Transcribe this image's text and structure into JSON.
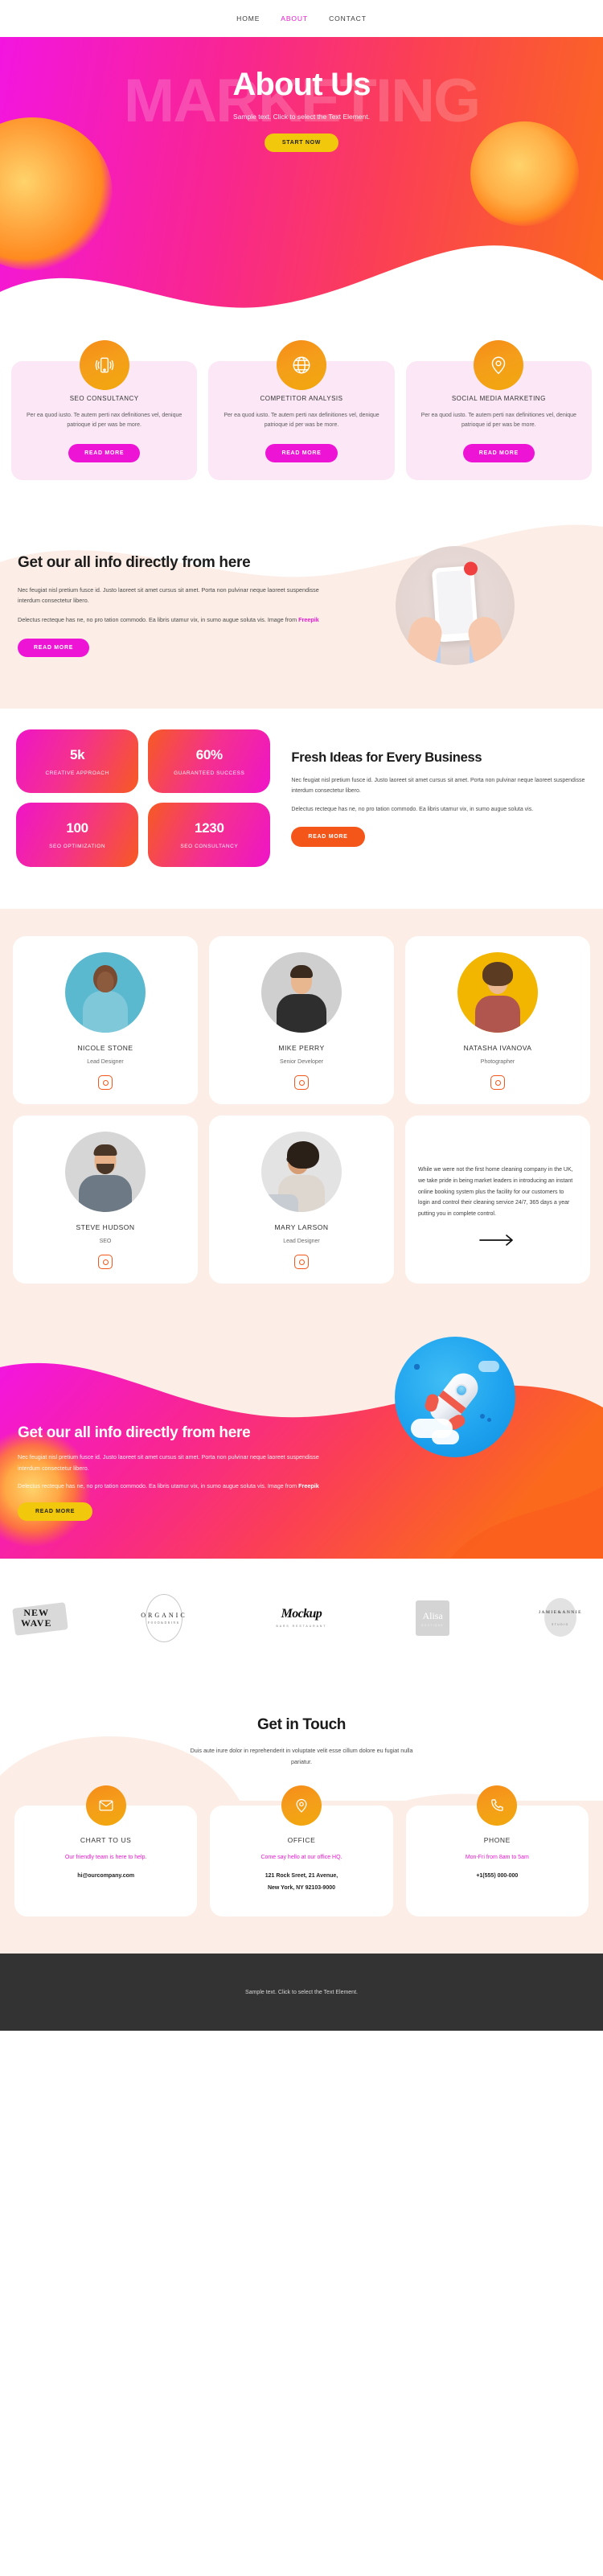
{
  "nav": {
    "items": [
      {
        "label": "HOME",
        "active": false
      },
      {
        "label": "ABOUT",
        "active": true
      },
      {
        "label": "CONTACT",
        "active": false
      }
    ]
  },
  "hero": {
    "ghost_word": "MARKETING",
    "title": "About Us",
    "subtitle": "Sample text. Click to select the Text Element.",
    "cta_label": "START NOW"
  },
  "services": {
    "cards": [
      {
        "icon": "mobile-phone-icon",
        "title": "SEO CONSULTANCY",
        "text": "Per ea quod iusto. Te autem perti nax definitiones vel, denique patrioque id per was be more.",
        "button": "READ MORE"
      },
      {
        "icon": "globe-icon",
        "title": "COMPETITOR ANALYSIS",
        "text": "Per ea quod iusto. Te autem perti nax definitiones vel, denique patrioque id per was be more.",
        "button": "READ MORE"
      },
      {
        "icon": "map-pin-icon",
        "title": "SOCIAL MEDIA MARKETING",
        "text": "Per ea quod iusto. Te autem perti nax definitiones vel, denique patrioque id per was be more.",
        "button": "READ MORE"
      }
    ]
  },
  "info": {
    "title": "Get our all info directly from here",
    "paragraph1": "Nec feugiat nisl pretium fusce id. Justo laoreet sit amet cursus sit amet. Porta non pulvinar neque laoreet suspendisse interdum consectetur libero.",
    "paragraph2_prefix": "Delectus recteque has ne, no pro tation commodo. Ea libris utamur vix, in sumo augue soluta vis. Image from ",
    "paragraph2_link": "Freepik",
    "button": "READ MORE"
  },
  "stats": {
    "items": [
      {
        "number": "5k",
        "label": "CREATIVE APPROACH"
      },
      {
        "number": "60%",
        "label": "GUARANTEED SUCCESS"
      },
      {
        "number": "100",
        "label": "SEO OPTIMIZATION"
      },
      {
        "number": "1230",
        "label": "SEO CONSULTANCY"
      }
    ],
    "title": "Fresh Ideas for Every Business",
    "paragraph1": "Nec feugiat nisl pretium fusce id. Justo laoreet sit amet cursus sit amet. Porta non pulvinar neque laoreet suspendisse interdum consectetur libero.",
    "paragraph2": "Delectus recteque has ne, no pro tation commodo. Ea libris utamur vix, in sumo augue soluta vis.",
    "button": "READ MORE"
  },
  "team": {
    "members": [
      {
        "name": "NICOLE STONE",
        "role": "Lead Designer"
      },
      {
        "name": "MIKE PERRY",
        "role": "Senior Developer"
      },
      {
        "name": "NATASHA IVANOVA",
        "role": "Photographer"
      },
      {
        "name": "STEVE HUDSON",
        "role": "SEO"
      },
      {
        "name": "MARY LARSON",
        "role": "Lead Designer"
      }
    ],
    "quote": "While we were not the first home cleaning company in the UK, we take pride in being market leaders in introducing an instant online booking system plus the facility for our customers to login and control their cleaning service 24/7, 365 days a year putting you in complete control."
  },
  "cta": {
    "title": "Get our all info directly from here",
    "paragraph1": "Nec feugiat nisl pretium fusce id. Justo laoreet sit amet cursus sit amet. Porta non pulvinar neque laoreet suspendisse interdum consectetur libero.",
    "paragraph2_prefix": "Delectus recteque has ne, no pro tation commodo. Ea libris utamur vix, in sumo augue soluta vis. Image from ",
    "paragraph2_link": "Freepik",
    "button": "READ MORE"
  },
  "logos": [
    {
      "name": "NEW WAVE",
      "line1": "NEW",
      "line2": "WAVE"
    },
    {
      "name": "ORGANIC",
      "line1": "ORGANIC",
      "line2": "FOOD&DRINK"
    },
    {
      "name": "Mockup",
      "line1": "Mockup",
      "line2": "BARS RESTAURANT"
    },
    {
      "name": "Alisa",
      "line1": "Alisa",
      "line2": "BOUTIQUE"
    },
    {
      "name": "JAMIE&ANNIE",
      "line1": "JAMIE&ANNIE",
      "line2": "STUDIO"
    }
  ],
  "contact": {
    "title": "Get in Touch",
    "subtitle": "Duis aute irure dolor in reprehenderit in voluptate velit esse cillum dolore eu fugiat nulla pariatur.",
    "cards": [
      {
        "icon": "envelope-icon",
        "title": "CHART TO US",
        "note": "Our friendly team is here to help.",
        "value": "hi@ourcompany.com"
      },
      {
        "icon": "map-pin-icon",
        "title": "OFFICE",
        "note": "Come say hello at our office HQ.",
        "value": "121 Rock Sreet, 21 Avenue,\nNew York, NY 92103-9000"
      },
      {
        "icon": "phone-icon",
        "title": "PHONE",
        "note": "Mon-Fri from 8am to 5am",
        "value": "+1(555) 000-000"
      }
    ]
  },
  "footer": {
    "text": "Sample text. Click to select the Text Element."
  },
  "colors": {
    "magenta": "#ee14d6",
    "orange": "#f4561a",
    "yellow": "#f2c80c",
    "cream": "#fceee6",
    "pink_card": "#fbe7f6",
    "footer_dark": "#333333"
  }
}
